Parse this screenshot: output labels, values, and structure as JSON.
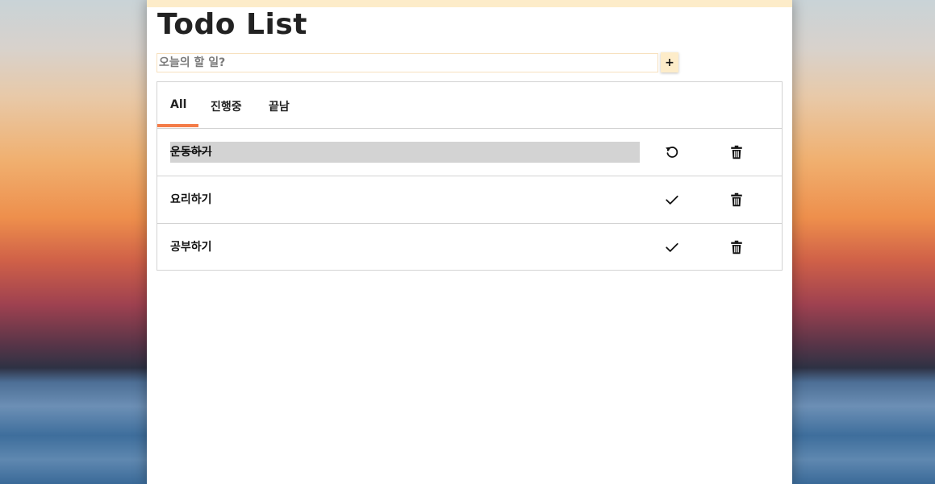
{
  "app": {
    "title": "Todo List",
    "input": {
      "placeholder": "오늘의 할 일?",
      "value": ""
    },
    "add_button_label": "+"
  },
  "tabs": [
    {
      "label": "All",
      "selected": true
    },
    {
      "label": "진행중",
      "selected": false
    },
    {
      "label": "끝남",
      "selected": false
    }
  ],
  "tasks": [
    {
      "text": "운동하기",
      "done": true,
      "action_icon": "undo-icon",
      "delete_icon": "trash-icon"
    },
    {
      "text": "요리하기",
      "done": false,
      "action_icon": "check-icon",
      "delete_icon": "trash-icon"
    },
    {
      "text": "공부하기",
      "done": false,
      "action_icon": "check-icon",
      "delete_icon": "trash-icon"
    }
  ],
  "colors": {
    "accent": "#f47c48",
    "button_bg": "#fdecc9",
    "done_bg": "#d3d3d3"
  }
}
